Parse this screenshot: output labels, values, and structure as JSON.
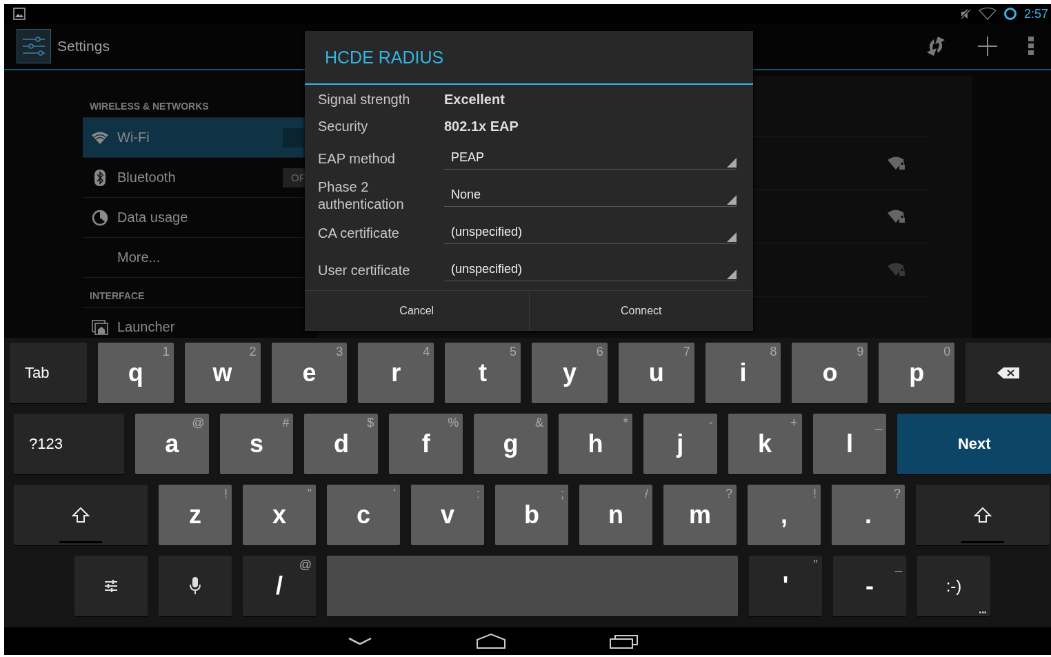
{
  "status_bar": {
    "time": "2:57"
  },
  "action_bar": {
    "title": "Settings"
  },
  "sidebar": {
    "sections": [
      {
        "header": "WIRELESS & NETWORKS",
        "items": [
          {
            "label": "Wi-Fi",
            "kind": "wifi",
            "selected": true,
            "switch": {
              "on": true
            }
          },
          {
            "label": "Bluetooth",
            "kind": "bluetooth",
            "selected": false,
            "switch": {
              "on": false,
              "label": "OF"
            }
          },
          {
            "label": "Data usage",
            "kind": "data",
            "selected": false
          },
          {
            "label": "More...",
            "kind": "plain",
            "selected": false
          }
        ]
      },
      {
        "header": "INTERFACE",
        "items": [
          {
            "label": "Launcher",
            "kind": "launcher",
            "selected": false
          }
        ]
      }
    ]
  },
  "networks": [
    {
      "kind": "strong"
    },
    {
      "kind": "strong"
    },
    {
      "kind": "weak"
    }
  ],
  "dialog": {
    "title": "HCDE RADIUS",
    "fields": [
      {
        "kind": "info",
        "label": "Signal strength",
        "value": "Excellent"
      },
      {
        "kind": "info",
        "label": "Security",
        "value": "802.1x EAP"
      },
      {
        "kind": "dropdown",
        "label": "EAP method",
        "value": "PEAP"
      },
      {
        "kind": "dropdown",
        "label": "Phase 2 authentication",
        "value": "None"
      },
      {
        "kind": "dropdown",
        "label": "CA certificate",
        "value": "(unspecified)"
      },
      {
        "kind": "dropdown",
        "label": "User certificate",
        "value": "(unspecified)"
      }
    ],
    "buttons": [
      "Cancel",
      "Connect"
    ]
  },
  "keyboard": {
    "rows": [
      [
        {
          "kind": "tab",
          "label": "Tab"
        },
        {
          "kind": "letter",
          "label": "q",
          "hint": "1"
        },
        {
          "kind": "letter",
          "label": "w",
          "hint": "2"
        },
        {
          "kind": "letter",
          "label": "e",
          "hint": "3"
        },
        {
          "kind": "letter",
          "label": "r",
          "hint": "4"
        },
        {
          "kind": "letter",
          "label": "t",
          "hint": "5"
        },
        {
          "kind": "letter",
          "label": "y",
          "hint": "6"
        },
        {
          "kind": "letter",
          "label": "u",
          "hint": "7"
        },
        {
          "kind": "letter",
          "label": "i",
          "hint": "8"
        },
        {
          "kind": "letter",
          "label": "o",
          "hint": "9"
        },
        {
          "kind": "letter",
          "label": "p",
          "hint": "0"
        },
        {
          "kind": "backspace"
        }
      ],
      [
        {
          "kind": "symbols",
          "label": "?123"
        },
        {
          "kind": "letter",
          "label": "a",
          "hint": "@"
        },
        {
          "kind": "letter",
          "label": "s",
          "hint": "#"
        },
        {
          "kind": "letter",
          "label": "d",
          "hint": "$"
        },
        {
          "kind": "letter",
          "label": "f",
          "hint": "%"
        },
        {
          "kind": "letter",
          "label": "g",
          "hint": "&"
        },
        {
          "kind": "letter",
          "label": "h",
          "hint": "*"
        },
        {
          "kind": "letter",
          "label": "j",
          "hint": "-"
        },
        {
          "kind": "letter",
          "label": "k",
          "hint": "+"
        },
        {
          "kind": "letter",
          "label": "l",
          "hint": "_"
        },
        {
          "kind": "action",
          "label": "Next"
        }
      ],
      [
        {
          "kind": "shift"
        },
        {
          "kind": "letter",
          "label": "z",
          "hint": "!"
        },
        {
          "kind": "letter",
          "label": "x",
          "hint": "\""
        },
        {
          "kind": "letter",
          "label": "c",
          "hint": "'"
        },
        {
          "kind": "letter",
          "label": "v",
          "hint": ":"
        },
        {
          "kind": "letter",
          "label": "b",
          "hint": ";"
        },
        {
          "kind": "letter",
          "label": "n",
          "hint": "/"
        },
        {
          "kind": "letter",
          "label": "m",
          "hint": "?"
        },
        {
          "kind": "letter",
          "label": ",",
          "hint": "!"
        },
        {
          "kind": "letter",
          "label": ".",
          "hint": "?"
        },
        {
          "kind": "shift"
        }
      ],
      [
        {
          "kind": "settings"
        },
        {
          "kind": "voice"
        },
        {
          "kind": "dark",
          "label": "/",
          "hint": "@"
        },
        {
          "kind": "space"
        },
        {
          "kind": "dark",
          "label": "'",
          "hint": "\""
        },
        {
          "kind": "dark",
          "label": "-",
          "hint": "_"
        },
        {
          "kind": "emoji",
          "label": ":-)"
        }
      ]
    ]
  }
}
